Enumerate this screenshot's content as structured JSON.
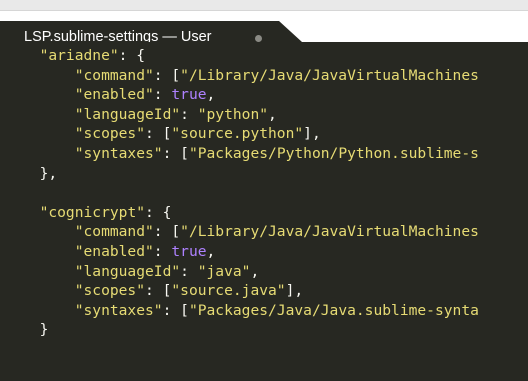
{
  "tab": {
    "title": "LSP.sublime-settings — User",
    "dirty_indicator": "●"
  },
  "colors": {
    "editor_background": "#272822",
    "foreground": "#f8f8f2",
    "string": "#e6db74",
    "constant": "#ae81ff",
    "tab_bar": "#ffffff"
  },
  "code_lines": [
    {
      "indent": "  ",
      "parts": [
        {
          "t": "str",
          "v": "\"ariadne\""
        },
        {
          "t": "pun",
          "v": ": {"
        }
      ]
    },
    {
      "indent": "      ",
      "parts": [
        {
          "t": "str",
          "v": "\"command\""
        },
        {
          "t": "pun",
          "v": ": ["
        },
        {
          "t": "str",
          "v": "\"/Library/Java/JavaVirtualMachines"
        }
      ]
    },
    {
      "indent": "      ",
      "parts": [
        {
          "t": "str",
          "v": "\"enabled\""
        },
        {
          "t": "pun",
          "v": ": "
        },
        {
          "t": "kw",
          "v": "true"
        },
        {
          "t": "pun",
          "v": ","
        }
      ]
    },
    {
      "indent": "      ",
      "parts": [
        {
          "t": "str",
          "v": "\"languageId\""
        },
        {
          "t": "pun",
          "v": ": "
        },
        {
          "t": "str",
          "v": "\"python\""
        },
        {
          "t": "pun",
          "v": ","
        }
      ]
    },
    {
      "indent": "      ",
      "parts": [
        {
          "t": "str",
          "v": "\"scopes\""
        },
        {
          "t": "pun",
          "v": ": ["
        },
        {
          "t": "str",
          "v": "\"source.python\""
        },
        {
          "t": "pun",
          "v": "],"
        }
      ]
    },
    {
      "indent": "      ",
      "parts": [
        {
          "t": "str",
          "v": "\"syntaxes\""
        },
        {
          "t": "pun",
          "v": ": ["
        },
        {
          "t": "str",
          "v": "\"Packages/Python/Python.sublime-s"
        }
      ]
    },
    {
      "indent": "  ",
      "parts": [
        {
          "t": "pun",
          "v": "},"
        }
      ]
    },
    {
      "indent": "",
      "parts": []
    },
    {
      "indent": "  ",
      "parts": [
        {
          "t": "str",
          "v": "\"cognicrypt\""
        },
        {
          "t": "pun",
          "v": ": {"
        }
      ]
    },
    {
      "indent": "      ",
      "parts": [
        {
          "t": "str",
          "v": "\"command\""
        },
        {
          "t": "pun",
          "v": ": ["
        },
        {
          "t": "str",
          "v": "\"/Library/Java/JavaVirtualMachines"
        }
      ]
    },
    {
      "indent": "      ",
      "parts": [
        {
          "t": "str",
          "v": "\"enabled\""
        },
        {
          "t": "pun",
          "v": ": "
        },
        {
          "t": "kw",
          "v": "true"
        },
        {
          "t": "pun",
          "v": ","
        }
      ]
    },
    {
      "indent": "      ",
      "parts": [
        {
          "t": "str",
          "v": "\"languageId\""
        },
        {
          "t": "pun",
          "v": ": "
        },
        {
          "t": "str",
          "v": "\"java\""
        },
        {
          "t": "pun",
          "v": ","
        }
      ]
    },
    {
      "indent": "      ",
      "parts": [
        {
          "t": "str",
          "v": "\"scopes\""
        },
        {
          "t": "pun",
          "v": ": ["
        },
        {
          "t": "str",
          "v": "\"source.java\""
        },
        {
          "t": "pun",
          "v": "],"
        }
      ]
    },
    {
      "indent": "      ",
      "parts": [
        {
          "t": "str",
          "v": "\"syntaxes\""
        },
        {
          "t": "pun",
          "v": ": ["
        },
        {
          "t": "str",
          "v": "\"Packages/Java/Java.sublime-synta"
        }
      ]
    },
    {
      "indent": "  ",
      "parts": [
        {
          "t": "pun",
          "v": "}"
        }
      ]
    }
  ]
}
